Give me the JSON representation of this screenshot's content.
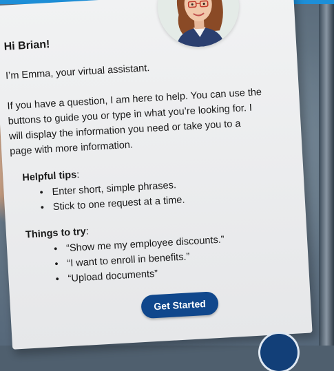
{
  "assistant": {
    "greeting": "Hi Brian!",
    "intro": "I’m Emma, your virtual assistant.",
    "help_text": "If you have a question, I am here to help. You can use the buttons to guide you or type in what you’re looking for. I will display the information you need or take you to a page with more information.",
    "tips_label": "Helpful tips",
    "tips_colon": ":",
    "tips": [
      "Enter short, simple phrases.",
      "Stick to one request at a time."
    ],
    "try_label": "Things to try",
    "try_colon": ":",
    "things_to_try": [
      "“Show me my employee discounts.”",
      "“I want to enroll in benefits.”",
      "“Upload documents”"
    ],
    "start_button_label": "Get Started",
    "avatar_icon": "assistant-avatar-icon"
  },
  "colors": {
    "accent_bar": "#1d8fd8",
    "button": "#10478c",
    "card": "#eceef0"
  }
}
